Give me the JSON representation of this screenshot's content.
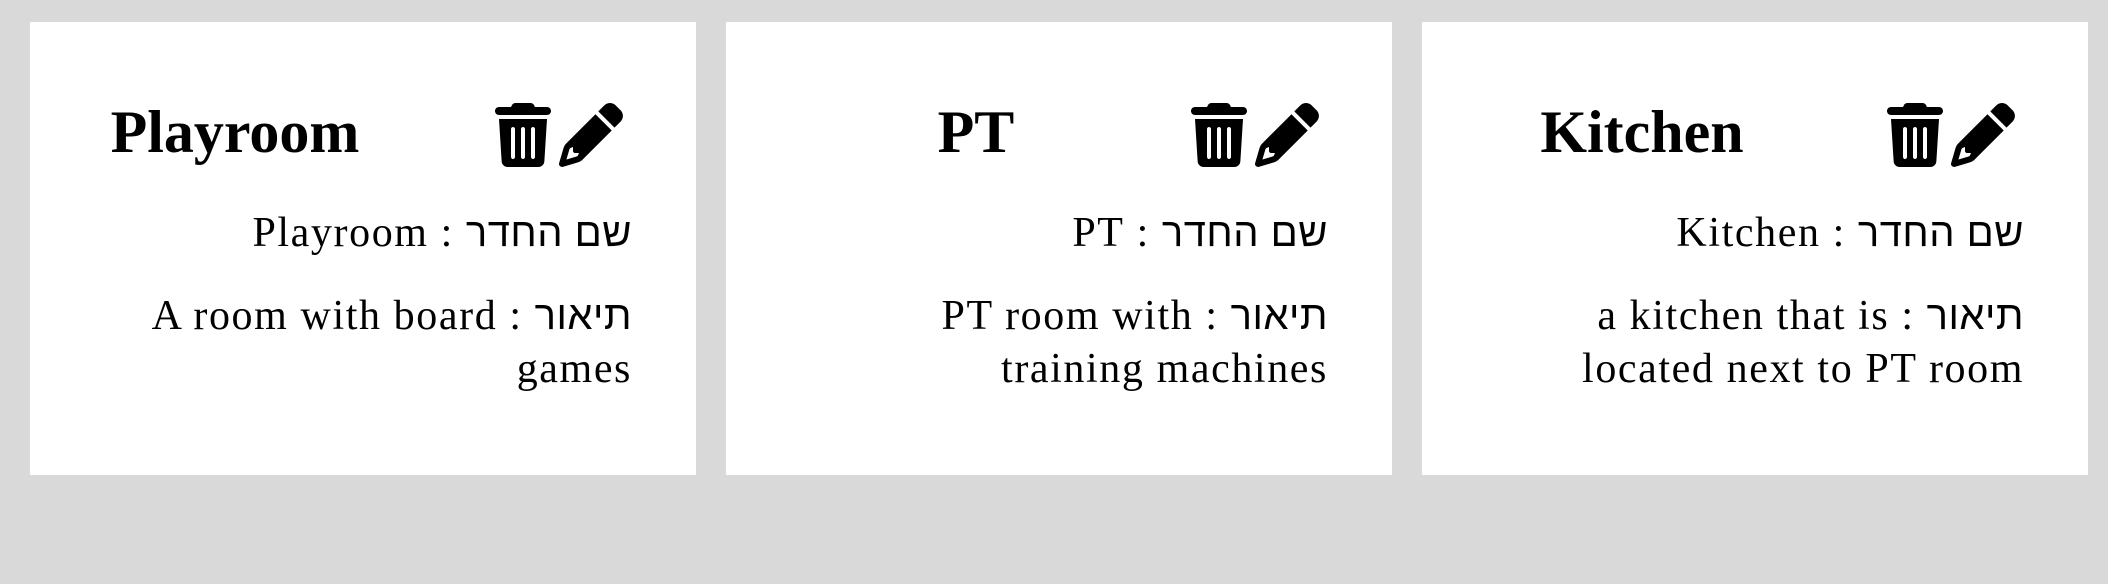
{
  "labels": {
    "name_label": "שם החדר",
    "description_label": "תיאור",
    "separator": ":"
  },
  "icons": {
    "delete": "trash-icon",
    "edit": "pencil-icon"
  },
  "rooms": [
    {
      "title": "Playroom",
      "name": "Playroom",
      "description": "A room with board games"
    },
    {
      "title": "PT",
      "name": "PT",
      "description": "PT room with training machines"
    },
    {
      "title": "Kitchen",
      "name": "Kitchen",
      "description": "a kitchen that is located next to PT room"
    }
  ]
}
